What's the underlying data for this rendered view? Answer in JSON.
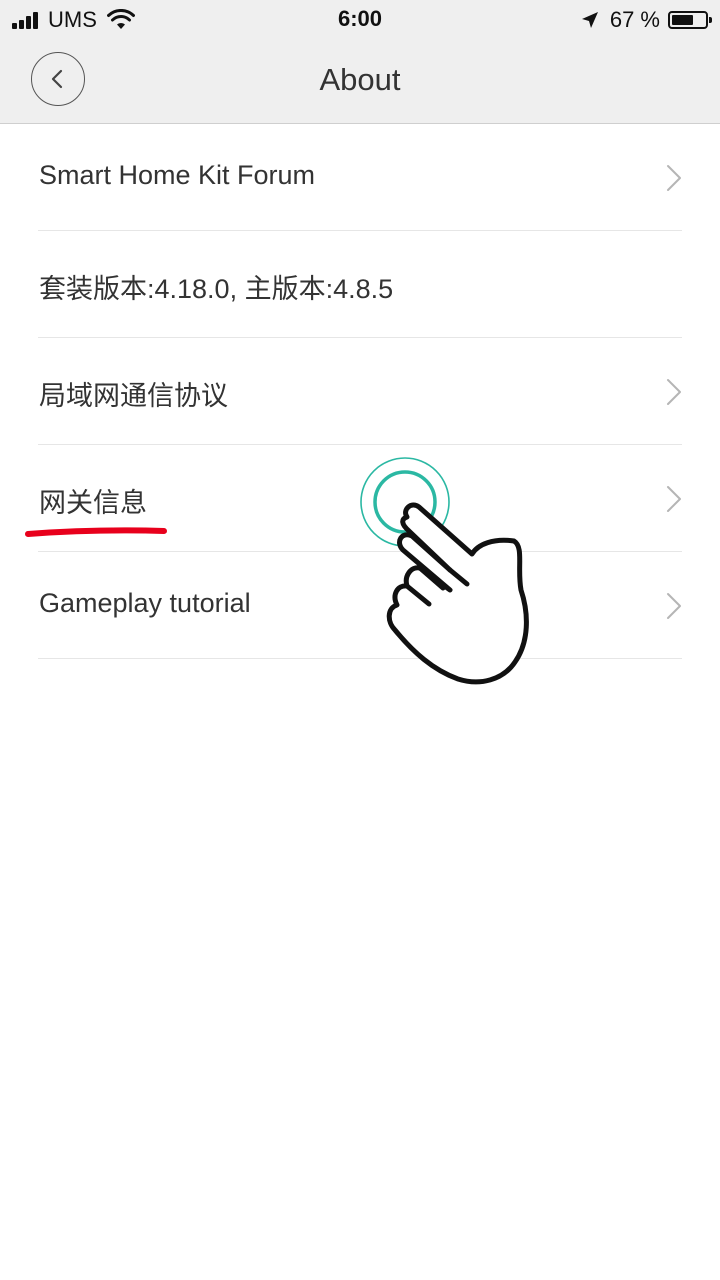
{
  "status_bar": {
    "carrier": "UMS",
    "time": "6:00",
    "battery_percent": "67 %",
    "battery_level": 0.67,
    "icons": [
      "signal-icon",
      "wifi-icon",
      "location-arrow-icon",
      "battery-icon"
    ]
  },
  "nav": {
    "title": "About",
    "back_icon": "chevron-left-icon"
  },
  "items": [
    {
      "label": "Smart Home Kit Forum",
      "has_chevron": true
    },
    {
      "label": "套装版本:4.18.0, 主版本:4.8.5",
      "has_chevron": false
    },
    {
      "label": "局域网通信协议",
      "has_chevron": true
    },
    {
      "label": "网关信息",
      "has_chevron": true
    },
    {
      "label": "Gameplay tutorial",
      "has_chevron": true
    }
  ],
  "colors": {
    "accent_tap": "#2bb8a3",
    "highlight_underline": "#e8001c",
    "nav_background": "#efefef"
  }
}
